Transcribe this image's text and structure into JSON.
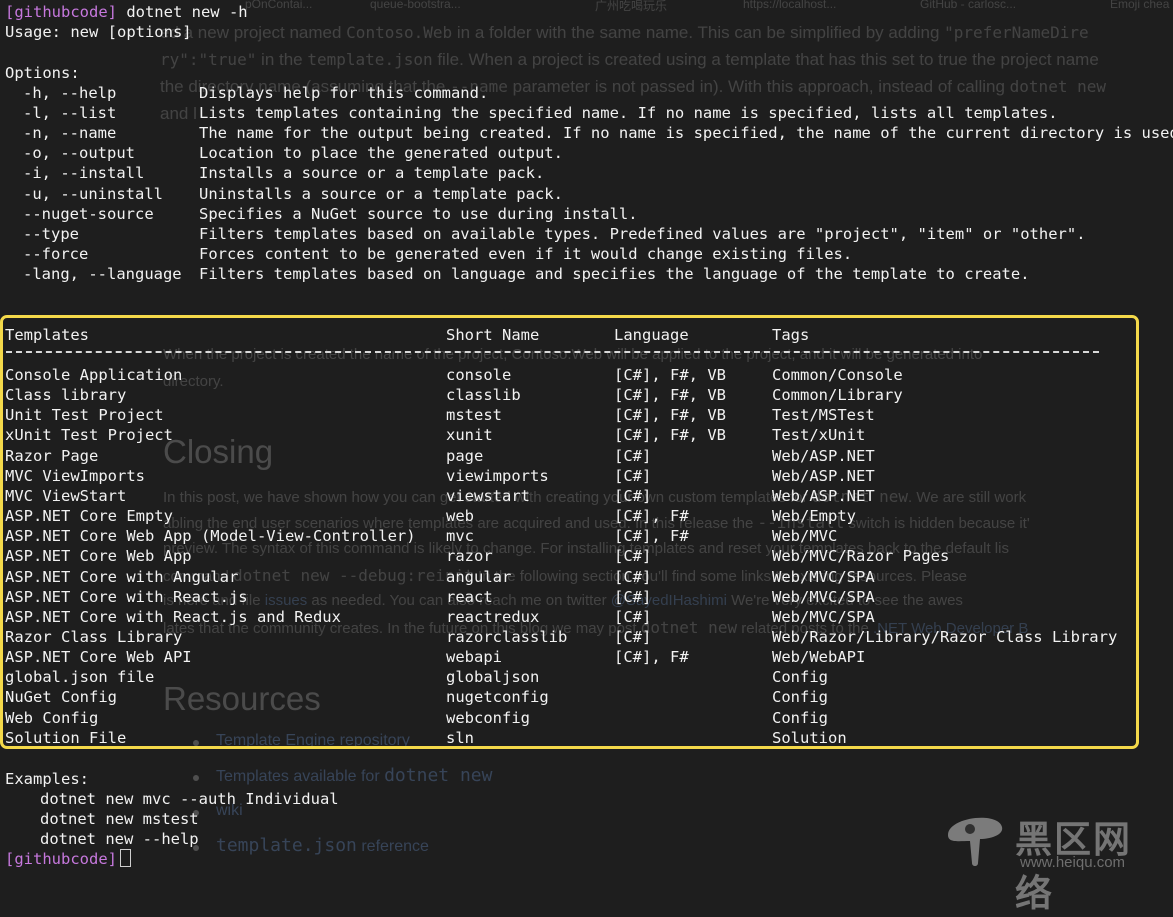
{
  "background_page": {
    "tabs": [
      "pOnContai...",
      "queue-bootstra...",
      "广州吃喝玩乐",
      "https://localhost...",
      "GitHub - carlosc...",
      "Emoji chea"
    ],
    "para1_lines": [
      {
        "pre": "ed a new project named ",
        "code": "Contoso.Web",
        "post": " in a folder with the same name. This can be simplified by adding ",
        "code2": "\"preferNameDire"
      },
      {
        "pre": "",
        "code": "ry\":\"true\"",
        "post": " in the ",
        "code2": "template.json",
        "post2": " file. When a project is created using a template that has this set to true the project name"
      },
      {
        "pre": "the directory name (assuming that the ",
        "code": "--name",
        "post": " parameter is not passed in). With this approach, instead of calling ",
        "code2": "dotnet new"
      },
      {
        "pre": "and l",
        "code": "",
        "post": ""
      }
    ],
    "para2_lines": [
      "When the project is created the name of the project, Contoso.Web will be applied to the project, and it will be generated into",
      "directory."
    ],
    "heading_closing": "Closing",
    "closing_lines": [
      {
        "pre": "In this post, we have shown how you can get started with creating your own custom templates for ",
        "code": "dotnet new",
        "post": ". We are still work"
      },
      {
        "pre": "abling the end user scenarios where templates are acquired and used. In this release the ",
        "code": "--install",
        "post": " switch is hidden because it'"
      },
      {
        "pre": "preview. The syntax of this command is likely to change. For installing templates and reset your templates back to the default lis",
        "code": "",
        "post": ""
      },
      {
        "pre": "command ",
        "code": "dotnet new --debug:reinit",
        "post": " In the following section you'll find some links to existing resources. Please"
      },
      {
        "pre": "is here and file ",
        "link": "issues",
        "post": " as needed. You can also reach me on twitter ",
        "link2": "@SayedIHashimi",
        "post2": " We're very excited to see the awes"
      },
      {
        "pre": "lates that the community creates. In the future on this blog we may post ",
        "code": "dotnet new",
        "post": " related posts to the ",
        "link": ".NET Web Developer B"
      }
    ],
    "heading_resources": "Resources",
    "resources": [
      {
        "text": "Template Engine repository",
        "code": ""
      },
      {
        "text": "Templates available for ",
        "code": "dotnet new"
      },
      {
        "text": "wiki",
        "code": ""
      },
      {
        "text": "",
        "code": "template.json",
        "tail": " reference"
      }
    ]
  },
  "terminal": {
    "prompt": "[githubcode]",
    "command": " dotnet new -h",
    "usage": "Usage: new [options]",
    "options_header": "Options:",
    "options": [
      {
        "flag": "-h, --help",
        "desc": "Displays help for this command."
      },
      {
        "flag": "-l, --list",
        "desc": "Lists templates containing the specified name. If no name is specified, lists all templates."
      },
      {
        "flag": "-n, --name",
        "desc": "The name for the output being created. If no name is specified, the name of the current directory is used."
      },
      {
        "flag": "-o, --output",
        "desc": "Location to place the generated output."
      },
      {
        "flag": "-i, --install",
        "desc": "Installs a source or a template pack."
      },
      {
        "flag": "-u, --uninstall",
        "desc": "Uninstalls a source or a template pack."
      },
      {
        "flag": "--nuget-source",
        "desc": "Specifies a NuGet source to use during install."
      },
      {
        "flag": "--type",
        "desc": "Filters templates based on available types. Predefined values are \"project\", \"item\" or \"other\"."
      },
      {
        "flag": "--force",
        "desc": "Forces content to be generated even if it would change existing files."
      },
      {
        "flag": "-lang, --language",
        "desc": "Filters templates based on language and specifies the language of the template to create."
      }
    ],
    "table": {
      "headers": [
        "Templates",
        "Short Name",
        "Language",
        "Tags"
      ],
      "rows": [
        [
          "Console Application",
          "console",
          "[C#], F#, VB",
          "Common/Console"
        ],
        [
          "Class library",
          "classlib",
          "[C#], F#, VB",
          "Common/Library"
        ],
        [
          "Unit Test Project",
          "mstest",
          "[C#], F#, VB",
          "Test/MSTest"
        ],
        [
          "xUnit Test Project",
          "xunit",
          "[C#], F#, VB",
          "Test/xUnit"
        ],
        [
          "Razor Page",
          "page",
          "[C#]",
          "Web/ASP.NET"
        ],
        [
          "MVC ViewImports",
          "viewimports",
          "[C#]",
          "Web/ASP.NET"
        ],
        [
          "MVC ViewStart",
          "viewstart",
          "[C#]",
          "Web/ASP.NET"
        ],
        [
          "ASP.NET Core Empty",
          "web",
          "[C#], F#",
          "Web/Empty"
        ],
        [
          "ASP.NET Core Web App (Model-View-Controller)",
          "mvc",
          "[C#], F#",
          "Web/MVC"
        ],
        [
          "ASP.NET Core Web App",
          "razor",
          "[C#]",
          "Web/MVC/Razor Pages"
        ],
        [
          "ASP.NET Core with Angular",
          "angular",
          "[C#]",
          "Web/MVC/SPA"
        ],
        [
          "ASP.NET Core with React.js",
          "react",
          "[C#]",
          "Web/MVC/SPA"
        ],
        [
          "ASP.NET Core with React.js and Redux",
          "reactredux",
          "[C#]",
          "Web/MVC/SPA"
        ],
        [
          "Razor Class Library",
          "razorclasslib",
          "[C#]",
          "Web/Razor/Library/Razor Class Library"
        ],
        [
          "ASP.NET Core Web API",
          "webapi",
          "[C#], F#",
          "Web/WebAPI"
        ],
        [
          "global.json file",
          "globaljson",
          "",
          "Config"
        ],
        [
          "NuGet Config",
          "nugetconfig",
          "",
          "Config"
        ],
        [
          "Web Config",
          "webconfig",
          "",
          "Config"
        ],
        [
          "Solution File",
          "sln",
          "",
          "Solution"
        ]
      ]
    },
    "examples_header": "Examples:",
    "examples": [
      "dotnet new mvc --auth Individual",
      "dotnet new mstest",
      "dotnet new --help"
    ],
    "end_prompt": "[githubcode]"
  },
  "watermark": {
    "text": "黑区网络",
    "url": "www.heiqu.com"
  },
  "colors": {
    "prompt": "#c678dd",
    "highlight_border": "#f4d94a",
    "terminal_text": "#f2f2f2",
    "background": "#1e1e1e"
  }
}
